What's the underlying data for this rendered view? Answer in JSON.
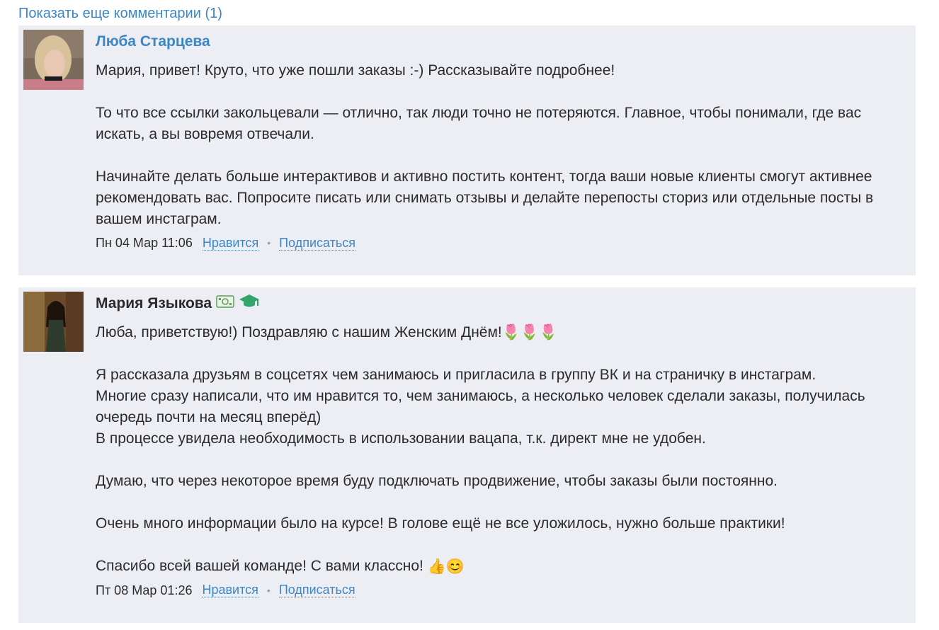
{
  "show_more": "Показать еще комментарии (1)",
  "comments": [
    {
      "author": "Люба Старцева",
      "paragraphs": [
        "Мария, привет! Круто, что уже пошли заказы :-) Рассказывайте подробнее!",
        "То что все ссылки закольцевали — отлично, так люди точно не потеряются. Главное, чтобы понимали, где вас искать, а вы вовремя отвечали.",
        "Начинайте делать больше интерактивов и активно постить контент, тогда ваши новые клиенты смогут активнее рекомендовать вас. Попросите писать или снимать отзывы и делайте перепосты сториз или отдельные посты в вашем инстаграм."
      ],
      "date": "Пн 04 Мар 11:06",
      "like": "Нравится",
      "subscribe": "Подписаться"
    },
    {
      "author": "Мария Языкова",
      "badges": [
        "money-badge-icon",
        "graduation-cap-icon"
      ],
      "paragraphs": [
        "Люба, приветствую!) Поздравляю с нашим Женским Днём!",
        "Я рассказала друзьям в соцсетях чем занимаюсь и пригласила в группу ВК и на страничку в инстаграм.",
        "Многие сразу написали, что им нравится то, чем занимаюсь, а несколько человек сделали заказы, получилась очередь почти на месяц вперёд)",
        "В процессе увидела необходимость в использовании вацапа, т.к. директ мне не удобен.",
        "Думаю, что через некоторое время буду подключать продвижение, чтобы заказы были постоянно.",
        "Очень много информации было на курсе! В голове ещё не все уложилось, нужно больше практики!",
        "Спасибо всей вашей команде! С вами классно!"
      ],
      "emoji_1": "🌷🌷🌷",
      "emoji_2": "👍😊",
      "date": "Пт 08 Мар 01:26",
      "like": "Нравится",
      "subscribe": "Подписаться"
    }
  ],
  "colors": {
    "link": "#3d86c4",
    "card_bg": "#edeef4",
    "text": "#2b2b2b"
  }
}
